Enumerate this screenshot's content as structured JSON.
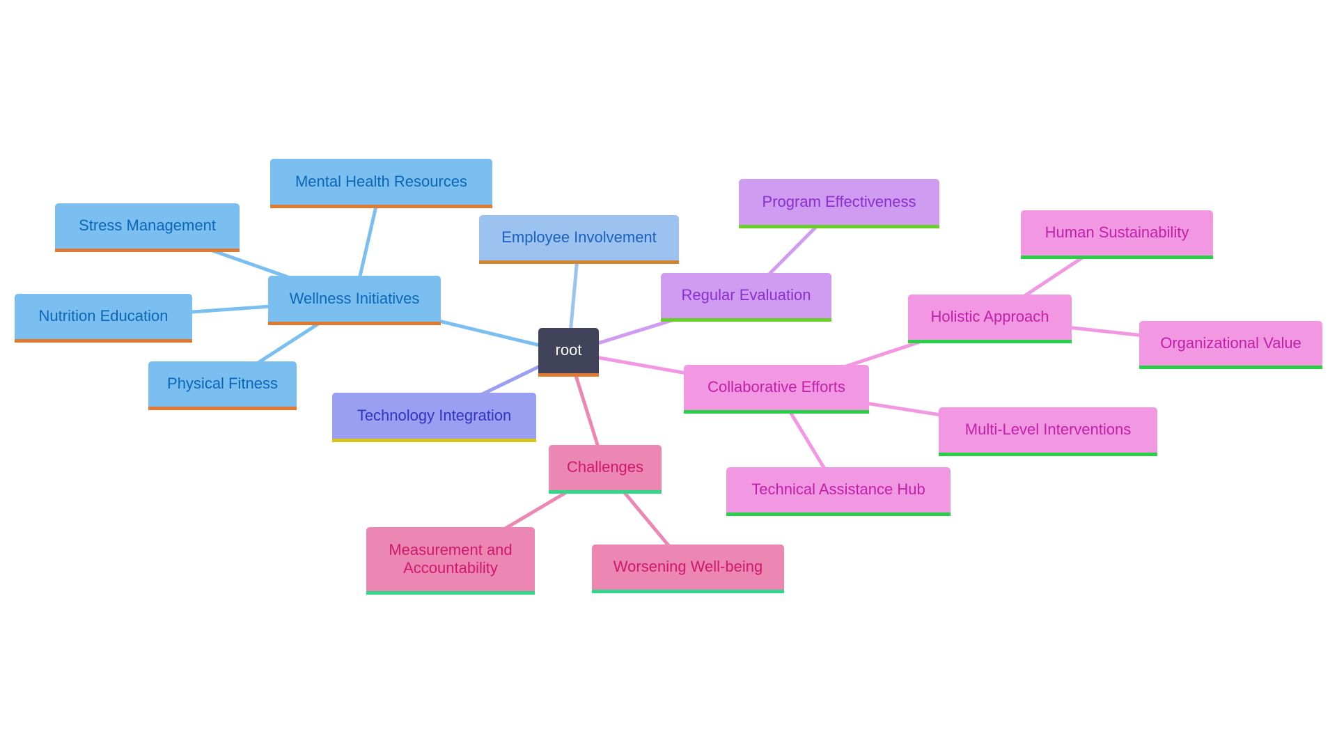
{
  "diagram": {
    "type": "mindmap",
    "root": {
      "id": "root",
      "label": "root"
    },
    "nodes": [
      {
        "id": "root",
        "label": "root",
        "fill": "#40435a",
        "text": "#ffffff",
        "bar": "#e07a30"
      },
      {
        "id": "wellness",
        "label": "Wellness Initiatives",
        "parent": "root",
        "fill": "#7bbff0",
        "text": "#0b66b8",
        "bar": "#e07a30",
        "edge": "#7bbff0"
      },
      {
        "id": "mental",
        "label": "Mental Health Resources",
        "parent": "wellness",
        "fill": "#7bbff0",
        "text": "#0b66b8",
        "bar": "#e07a30",
        "edge": "#7bbff0"
      },
      {
        "id": "stress",
        "label": "Stress Management",
        "parent": "wellness",
        "fill": "#7bbff0",
        "text": "#0b66b8",
        "bar": "#e07a30",
        "edge": "#7bbff0"
      },
      {
        "id": "nutrition",
        "label": "Nutrition Education",
        "parent": "wellness",
        "fill": "#7bbff0",
        "text": "#0b66b8",
        "bar": "#e07a30",
        "edge": "#7bbff0"
      },
      {
        "id": "physical",
        "label": "Physical Fitness",
        "parent": "wellness",
        "fill": "#7bbff0",
        "text": "#0b66b8",
        "bar": "#e07a30",
        "edge": "#7bbff0"
      },
      {
        "id": "employee",
        "label": "Employee Involvement",
        "parent": "root",
        "fill": "#9cc3ef",
        "text": "#1a60c0",
        "bar": "#d28530",
        "edge": "#9cc3ef"
      },
      {
        "id": "technology",
        "label": "Technology Integration",
        "parent": "root",
        "fill": "#9a9ff2",
        "text": "#2f35c0",
        "bar": "#d6c61c",
        "edge": "#9a9ff2"
      },
      {
        "id": "challenges",
        "label": "Challenges",
        "parent": "root",
        "fill": "#ec87b4",
        "text": "#d0186a",
        "bar": "#30d88a",
        "edge": "#ec87b4"
      },
      {
        "id": "measurement",
        "label": "Measurement and\nAccountability",
        "parent": "challenges",
        "fill": "#ec87b4",
        "text": "#d0186a",
        "bar": "#30d88a",
        "edge": "#ec87b4"
      },
      {
        "id": "worsening",
        "label": "Worsening Well-being",
        "parent": "challenges",
        "fill": "#ec87b4",
        "text": "#d0186a",
        "bar": "#30d88a",
        "edge": "#ec87b4"
      },
      {
        "id": "regular",
        "label": "Regular Evaluation",
        "parent": "root",
        "fill": "#cf9cf2",
        "text": "#8a2ed0",
        "bar": "#6ad028",
        "edge": "#cf9cf2"
      },
      {
        "id": "program",
        "label": "Program Effectiveness",
        "parent": "regular",
        "fill": "#cf9cf2",
        "text": "#8a2ed0",
        "bar": "#6ad028",
        "edge": "#cf9cf2"
      },
      {
        "id": "collab",
        "label": "Collaborative Efforts",
        "parent": "root",
        "fill": "#f298e2",
        "text": "#c020a8",
        "bar": "#28d048",
        "edge": "#f298e2"
      },
      {
        "id": "holistic",
        "label": "Holistic Approach",
        "parent": "collab",
        "fill": "#f298e2",
        "text": "#c020a8",
        "bar": "#28d048",
        "edge": "#f298e2"
      },
      {
        "id": "human",
        "label": "Human Sustainability",
        "parent": "holistic",
        "fill": "#f298e2",
        "text": "#c020a8",
        "bar": "#28d048",
        "edge": "#f298e2"
      },
      {
        "id": "orgvalue",
        "label": "Organizational Value",
        "parent": "holistic",
        "fill": "#f298e2",
        "text": "#c020a8",
        "bar": "#28d048",
        "edge": "#f298e2"
      },
      {
        "id": "multilevel",
        "label": "Multi-Level Interventions",
        "parent": "collab",
        "fill": "#f298e2",
        "text": "#c020a8",
        "bar": "#28d048",
        "edge": "#f298e2"
      },
      {
        "id": "techhub",
        "label": "Technical Assistance Hub",
        "parent": "collab",
        "fill": "#f298e2",
        "text": "#c020a8",
        "bar": "#28d048",
        "edge": "#f298e2"
      }
    ]
  }
}
